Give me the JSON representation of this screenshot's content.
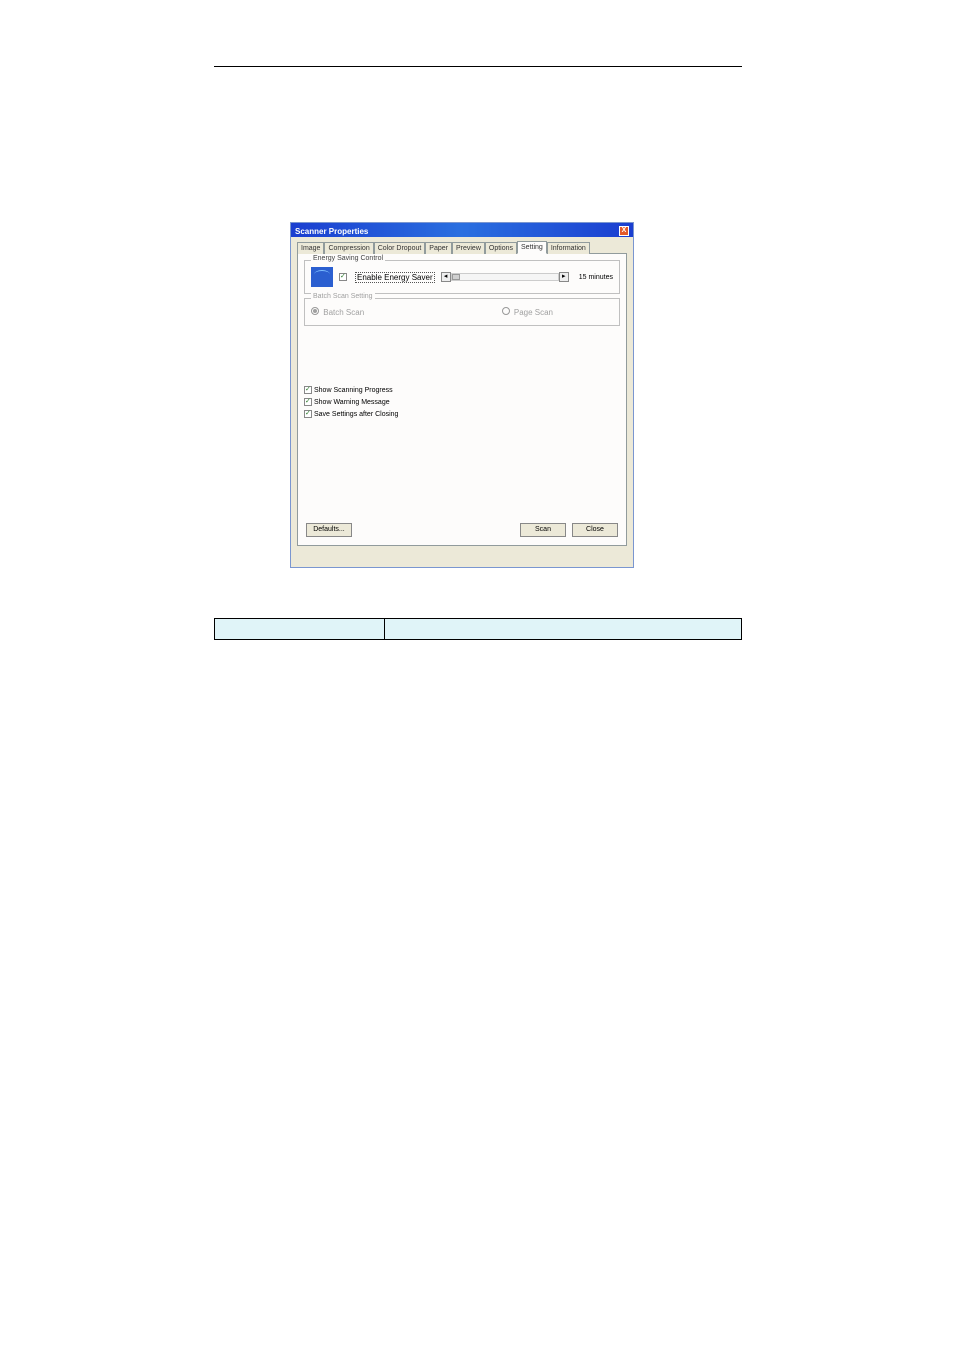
{
  "header": {
    "left": "",
    "right": ""
  },
  "dialog": {
    "title": "Scanner Properties",
    "close_glyph": "X",
    "tabs": {
      "list": [
        {
          "label": "Image"
        },
        {
          "label": "Compression"
        },
        {
          "label": "Color Dropout"
        },
        {
          "label": "Paper"
        },
        {
          "label": "Preview"
        },
        {
          "label": "Options"
        },
        {
          "label": "Setting"
        },
        {
          "label": "Information"
        }
      ],
      "active_index": 6
    },
    "energy_group": {
      "title": "Energy Saving Control",
      "enable_label": "Enable Energy Saver",
      "enable_checked": true,
      "slider_left_glyph": "◂",
      "slider_right_glyph": "▸",
      "slider_value_label": "15 minutes"
    },
    "batch_group": {
      "title": "Batch Scan Setting",
      "batch_label": "Batch Scan",
      "batch_selected": true,
      "page_label": "Page Scan",
      "page_selected": false
    },
    "checks": {
      "show_progress": {
        "label": "Show Scanning Progress",
        "checked": true
      },
      "show_warning": {
        "label": "Show Warning Message",
        "checked": true
      },
      "save_settings": {
        "label": "Save Settings after Closing",
        "checked": true
      }
    },
    "buttons": {
      "defaults": "Defaults...",
      "scan": "Scan",
      "close": "Close"
    }
  },
  "table": {
    "row1": {
      "col1": "",
      "col2": ""
    }
  }
}
